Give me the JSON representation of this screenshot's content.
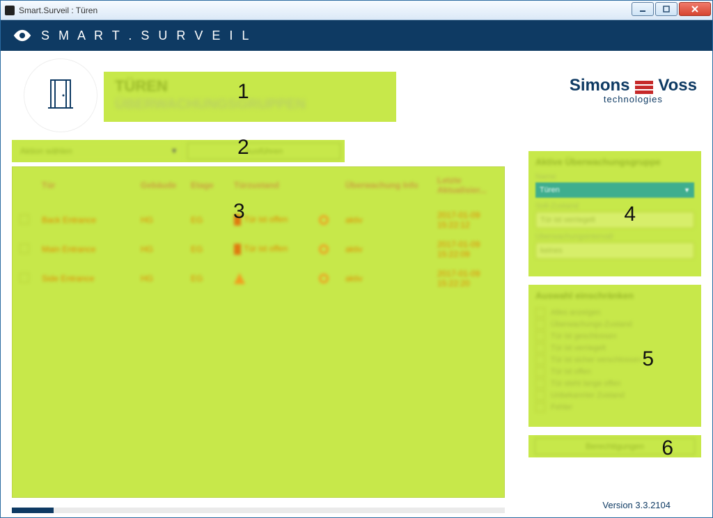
{
  "window": {
    "title": "Smart.Surveil : Türen"
  },
  "header": {
    "app_name": "S M A R T . S U R V E I L"
  },
  "logo": {
    "line1_a": "Simons",
    "line1_b": "Voss",
    "line2": "technologies"
  },
  "region1": {
    "title": "TÜREN",
    "subtitle": "ÜBERWACHUNGSGRUPPEN"
  },
  "region2": {
    "combo_text": "Aktion wählen",
    "button_text": "Ausführen"
  },
  "table": {
    "headers": [
      "",
      "Tür",
      "Gebäude",
      "Etage",
      "Türzustand",
      "",
      "Überwachung Info",
      "Letzte Aktualisier..."
    ],
    "rows": [
      {
        "name": "Back Entrance",
        "geb": "HG",
        "etage": "EG",
        "state_icon": "door",
        "state": "Tür ist offen",
        "info": "aktiv",
        "ts": "2017-01-09 15:22:12"
      },
      {
        "name": "Main Entrance",
        "geb": "HG",
        "etage": "EG",
        "state_icon": "door",
        "state": "Tür ist offen",
        "info": "aktiv",
        "ts": "2017-01-09 15:22:09"
      },
      {
        "name": "Side Entrance",
        "geb": "HG",
        "etage": "EG",
        "state_icon": "warn",
        "state": "",
        "info": "aktiv",
        "ts": "2017-01-09 15:22:20"
      }
    ]
  },
  "region4": {
    "header": "Aktive Überwachungsgruppe",
    "name_lbl": "Name",
    "name_val": "Türen",
    "soll_lbl": "Soll-Zustand",
    "soll_val": "Tür ist verriegelt",
    "int_lbl": "Überwachungsintervall",
    "int_val": "keines"
  },
  "region5": {
    "header": "Auswahl einschränken",
    "items": [
      "Alles anzeigen",
      "Überwachungs-Zustand",
      "Tür ist geschlossen",
      "Tür ist verriegelt",
      "Tür ist sicher verschlossen",
      "Tür ist offen",
      "Tür steht lange offen",
      "Unbekannter Zustand",
      "Fehler"
    ]
  },
  "region6": {
    "button": "Berechtigungen"
  },
  "version": "Version 3.3.2104",
  "callouts": {
    "c1": "1",
    "c2": "2",
    "c3": "3",
    "c4": "4",
    "c5": "5",
    "c6": "6"
  }
}
